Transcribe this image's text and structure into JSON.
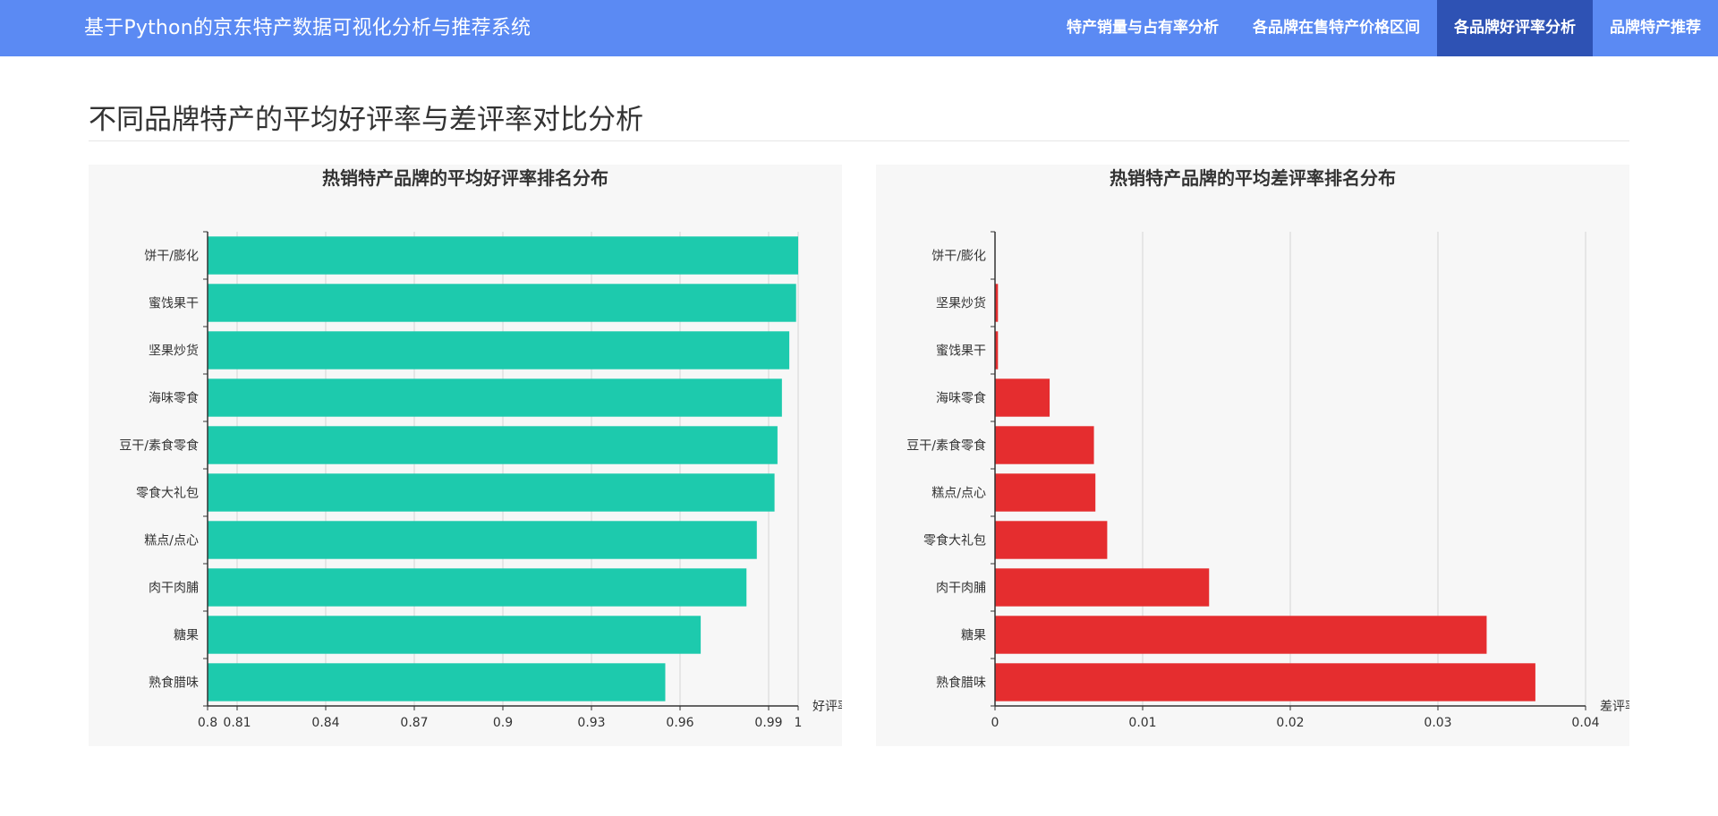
{
  "header": {
    "app_title": "基于Python的京东特产数据可视化分析与推荐系统",
    "nav": [
      {
        "label": "特产销量与占有率分析",
        "active": false
      },
      {
        "label": "各品牌在售特产价格区间",
        "active": false
      },
      {
        "label": "各品牌好评率分析",
        "active": true
      },
      {
        "label": "品牌特产推荐",
        "active": false
      }
    ]
  },
  "page": {
    "title": "不同品牌特产的平均好评率与差评率对比分析"
  },
  "chart_data": [
    {
      "type": "bar",
      "orientation": "horizontal",
      "title": "热销特产品牌的平均好评率排名分布",
      "xlabel": "好评率",
      "ylabel": "",
      "xlim": [
        0.8,
        1
      ],
      "ticks": [
        0.8,
        0.81,
        0.84,
        0.87,
        0.9,
        0.93,
        0.96,
        0.99,
        1
      ],
      "tick_labels": [
        "0.8",
        "0.81",
        "0.84",
        "0.87",
        "0.9",
        "0.93",
        "0.96",
        "0.99",
        "1"
      ],
      "grid": true,
      "categories": [
        "饼干/膨化",
        "蜜饯果干",
        "坚果炒货",
        "海味零食",
        "豆干/素食零食",
        "零食大礼包",
        "糕点/点心",
        "肉干肉脯",
        "糖果",
        "熟食腊味"
      ],
      "values": [
        1.0,
        0.9993,
        0.997,
        0.9945,
        0.993,
        0.992,
        0.986,
        0.9825,
        0.967,
        0.955
      ],
      "color": "#1dcaad"
    },
    {
      "type": "bar",
      "orientation": "horizontal",
      "title": "热销特产品牌的平均差评率排名分布",
      "xlabel": "差评率",
      "ylabel": "",
      "xlim": [
        0,
        0.04
      ],
      "ticks": [
        0,
        0.01,
        0.02,
        0.03,
        0.04
      ],
      "tick_labels": [
        "0",
        "0.01",
        "0.02",
        "0.03",
        "0.04"
      ],
      "grid": true,
      "categories": [
        "饼干/膨化",
        "坚果炒货",
        "蜜饯果干",
        "海味零食",
        "豆干/素食零食",
        "糕点/点心",
        "零食大礼包",
        "肉干肉脯",
        "糖果",
        "熟食腊味"
      ],
      "values": [
        0.0,
        0.0002,
        0.0002,
        0.0037,
        0.0067,
        0.0068,
        0.0076,
        0.0145,
        0.0333,
        0.0366
      ],
      "color": "#e52d2f"
    }
  ]
}
